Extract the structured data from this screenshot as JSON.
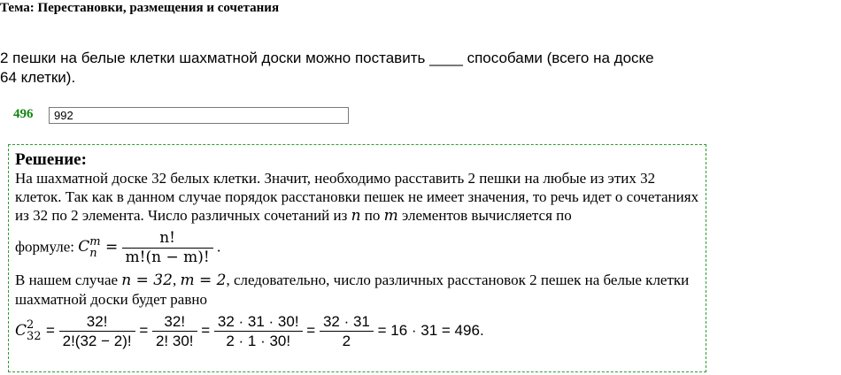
{
  "topic": "Тема: Перестановки, размещения и сочетания",
  "question": "2 пешки на белые клетки шахматной доски можно поставить ____ способами (всего на доске 64 клетки).",
  "correct_answer": "496",
  "user_answer": "992",
  "solution": {
    "title": "Решение:",
    "p1": "На шахматной доске 32 белых клетки. Значит, необходимо расставить 2 пешки на любые из этих 32 клеток. Так как в данном случае порядок расстановки пешек не имеет значения, то речь идет о сочетаниях из 32 по 2 элемента. Число различных сочетаний из",
    "p1_var_n": "n",
    "p1_mid": "по",
    "p1_var_m": "m",
    "p1_end": "элементов вычисляется по",
    "formula_label": "формуле:",
    "formula_lhs_sub": "n",
    "formula_lhs_sup": "m",
    "formula_lhs": "C",
    "formula_num": "n!",
    "formula_den": "m!(n − m)!",
    "formula_end": ".",
    "p2_start": "В нашем случае",
    "p2_n_eq": "n = 32",
    "p2_m_eq": "m = 2",
    "p2_end": ", следовательно, число различных расстановок 2 пешек на белые клетки шахматной доски будет равно",
    "calc": {
      "lhs": "C",
      "lhs_sub": "32",
      "lhs_sup": "2",
      "f1_num": "32!",
      "f1_den": "2!(32 − 2)!",
      "f2_num": "32!",
      "f2_den": "2! 30!",
      "f3_num": "32 · 31 · 30!",
      "f3_den": "2 · 1 · 30!",
      "f4_num": "32 · 31",
      "f4_den": "2",
      "tail": "= 16 · 31 = 496"
    }
  }
}
